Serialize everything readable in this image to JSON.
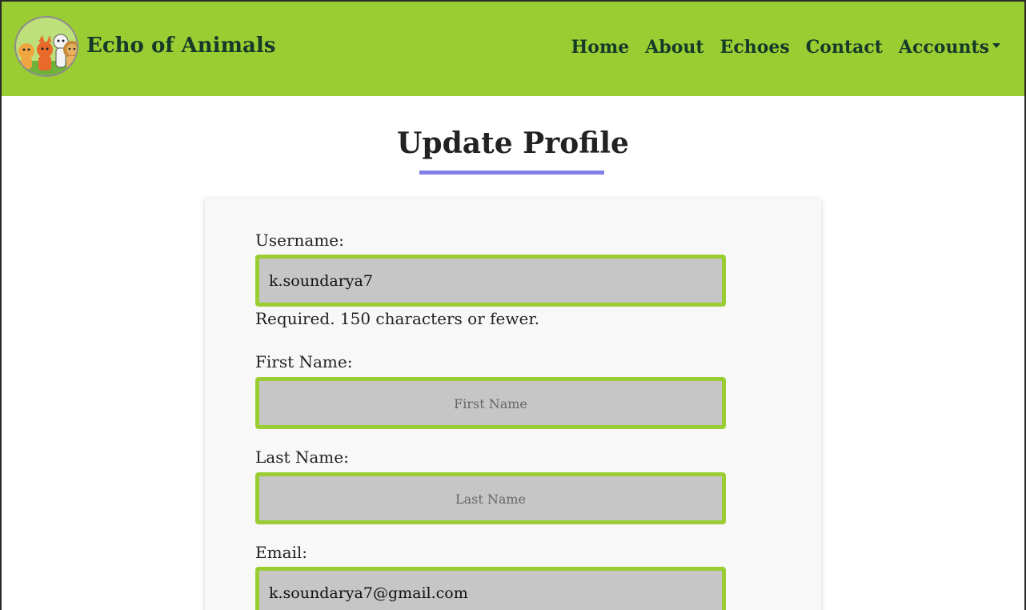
{
  "navbar": {
    "brand": "Echo of Animals",
    "links": [
      "Home",
      "About",
      "Echoes",
      "Contact",
      "Accounts"
    ]
  },
  "page": {
    "title": "Update Profile"
  },
  "form": {
    "username": {
      "label": "Username:",
      "value": "k.soundarya7",
      "help": "Required. 150 characters or fewer."
    },
    "first_name": {
      "label": "First Name:",
      "value": "",
      "placeholder": "First Name"
    },
    "last_name": {
      "label": "Last Name:",
      "value": "",
      "placeholder": "Last Name"
    },
    "email": {
      "label": "Email:",
      "value": "k.soundarya7@gmail.com"
    }
  },
  "colors": {
    "navbar_bg": "#9acd32",
    "nav_text": "#163a2a",
    "accent_underline": "#8080e8",
    "input_bg": "#c6c6c6",
    "input_border": "#9acd32"
  },
  "icons": {
    "logo": "animals-logo-icon",
    "dropdown": "caret-down-icon"
  }
}
